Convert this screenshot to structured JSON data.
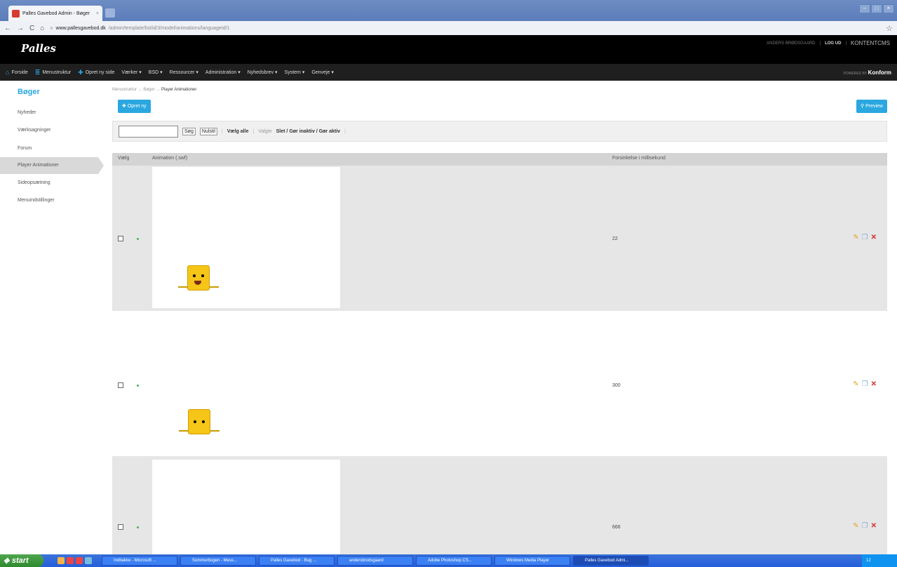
{
  "browser": {
    "tab_title": "Palles Gavebod Admin - Bøger",
    "url_host": "www.pallesgavebod.dk",
    "url_path": "/admin/template/list/id/3/model/animations/languageId/1"
  },
  "header": {
    "logo_text": "Palles",
    "user": "ANDERS BRØDSGAARD",
    "logout": "LOG UD",
    "brand": "KONTENTCMS"
  },
  "menu": {
    "items": [
      "Forside",
      "Menustruktur",
      "Opret ny side",
      "Værker ▾",
      "BSD ▾",
      "Ressourcer ▾",
      "Administration ▾",
      "Nyhedsbrev ▾",
      "System ▾",
      "Genveje ▾"
    ],
    "powered_by": "POWERED BY",
    "powered_brand": "Konform"
  },
  "sidebar": {
    "title": "Bøger",
    "items": [
      "Nyheder",
      "Værksagninger",
      "Forum",
      "Player Animationer",
      "Sideopsætning",
      "Menuindstillinger"
    ]
  },
  "breadcrumb": {
    "path": "Menustruktur → Bøger → ",
    "current": "Player Animationer"
  },
  "buttons": {
    "create": "Opret ny",
    "preview": "Preview"
  },
  "filter": {
    "search": "Søg",
    "reset": "Nulstil",
    "select_all": "Vælg alle",
    "selected_label": "Valgte",
    "actions": "Slet / Gør inaktiv / Gør aktiv"
  },
  "table": {
    "columns": [
      "Vælg",
      "Animation (.swf)",
      "Forsinkelse i millisekund"
    ],
    "rows": [
      {
        "delay": "22"
      },
      {
        "delay": "300"
      },
      {
        "delay": "666"
      }
    ]
  },
  "taskbar": {
    "start": "start",
    "items": [
      "Indbakke - Microsoft ...",
      "Sommerbogen - Mess...",
      "Palles Gavebod - Bug ...",
      "andersbrodsgaard",
      "Adobe Photoshop CS...",
      "Windows Media Player",
      "Palles Gavebod Admi..."
    ],
    "time": "12"
  },
  "colors": {
    "accent": "#2aa7df",
    "delete": "#d3302f",
    "edit": "#e2a31e"
  }
}
